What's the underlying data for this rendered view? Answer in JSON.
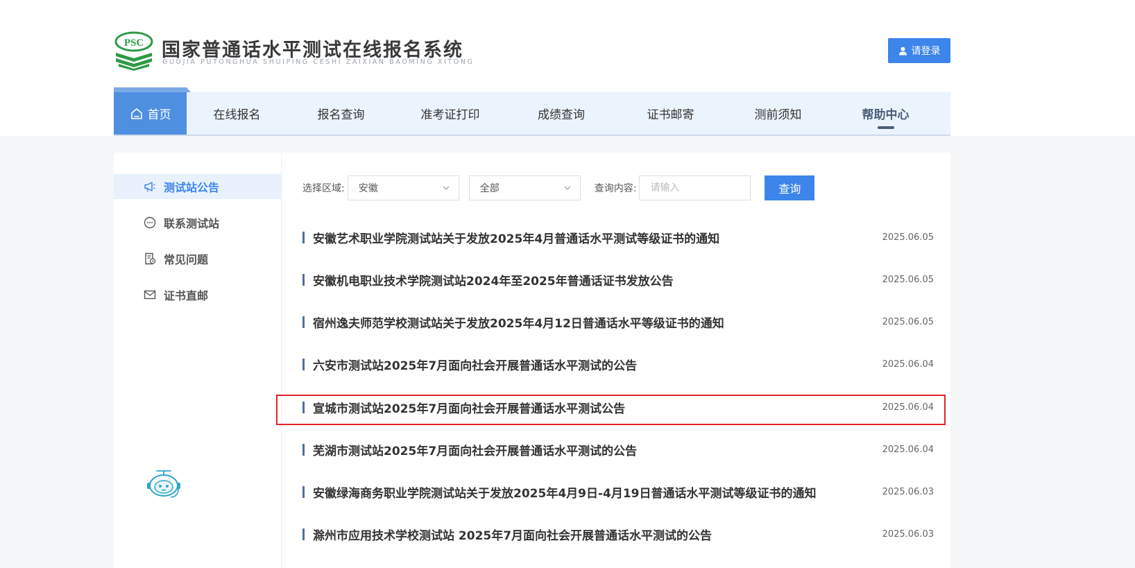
{
  "brand": {
    "logo_text": "PSC",
    "title": "国家普通话水平测试在线报名系统",
    "subtitle": "GUOJIA PUTONGHUA SHUIPING CESHI ZAIXIAN BAOMING XITONG",
    "logo_color": "#2e9a47"
  },
  "header": {
    "login_label": "请登录"
  },
  "nav": {
    "items": [
      {
        "label": "首页",
        "active": false
      },
      {
        "label": "在线报名"
      },
      {
        "label": "报名查询"
      },
      {
        "label": "准考证打印"
      },
      {
        "label": "成绩查询"
      },
      {
        "label": "证书邮寄"
      },
      {
        "label": "测前须知"
      },
      {
        "label": "帮助中心",
        "active": true
      }
    ]
  },
  "sidebar": {
    "items": [
      {
        "label": "测试站公告",
        "icon": "megaphone-icon",
        "active": true
      },
      {
        "label": "联系测试站",
        "icon": "chat-icon"
      },
      {
        "label": "常见问题",
        "icon": "faq-icon"
      },
      {
        "label": "证书直邮",
        "icon": "mail-icon"
      }
    ],
    "assistant_icon": "robot-assistant-icon"
  },
  "filter": {
    "region_label": "选择区域:",
    "region_value": "安徽",
    "city_value": "全部",
    "query_label": "查询内容:",
    "query_placeholder": "请输入",
    "query_button": "查询"
  },
  "notices": [
    {
      "title": "安徽艺术职业学院测试站关于发放2025年4月普通话水平测试等级证书的通知",
      "date": "2025.06.05"
    },
    {
      "title": "安徽机电职业技术学院测试站2024年至2025年普通话证书发放公告",
      "date": "2025.06.05"
    },
    {
      "title": "宿州逸夫师范学校测试站关于发放2025年4月12日普通话水平等级证书的通知",
      "date": "2025.06.05"
    },
    {
      "title": "六安市测试站2025年7月面向社会开展普通话水平测试的公告",
      "date": "2025.06.04"
    },
    {
      "title": "宣城市测试站2025年7月面向社会开展普通话水平测试公告",
      "date": "2025.06.04",
      "highlighted": true
    },
    {
      "title": "芜湖市测试站2025年7月面向社会开展普通话水平测试的公告",
      "date": "2025.06.04"
    },
    {
      "title": "安徽绿海商务职业学院测试站关于发放2025年4月9日-4月19日普通话水平测试等级证书的通知",
      "date": "2025.06.03"
    },
    {
      "title": "滁州市应用技术学校测试站 2025年7月面向社会开展普通话水平测试的公告",
      "date": "2025.06.03"
    }
  ],
  "colors": {
    "primary": "#3d85ea",
    "nav_background": "#ebf3fc",
    "highlight_border": "#e0232a"
  }
}
